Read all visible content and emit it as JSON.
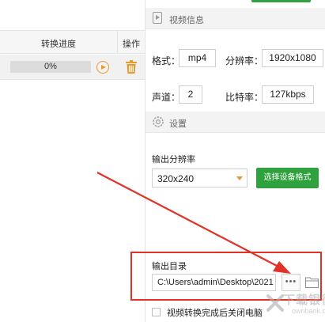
{
  "table": {
    "header": {
      "progress": "转换进度",
      "operation": "操作"
    },
    "rows": [
      {
        "progress_text": "0%",
        "progress": 0
      }
    ]
  },
  "video_info": {
    "title": "视频信息",
    "format_label": "格式：",
    "format_value": "mp4",
    "resolution_label": "分辨率：",
    "resolution_value": "1920x1080",
    "channels_label": "声道：",
    "channels_value": "2",
    "bitrate_label": "比特率：",
    "bitrate_value": "127kbps"
  },
  "settings": {
    "title": "设置",
    "output_resolution_label": "输出分辨率",
    "output_resolution_value": "320x240",
    "choose_format_button": "选择设备格式",
    "output_dir_label": "输出目录",
    "output_dir_value": "C:\\Users\\admin\\Desktop\\2021",
    "more_button": "•••",
    "shutdown_label": "视频转换完成后关闭电脑",
    "shutdown_checked": false
  },
  "watermark": {
    "cn": "下载银行",
    "en": "ownbank.cn"
  },
  "colors": {
    "accent": "#2fa13e",
    "orange": "#e69b2c",
    "annotation": "#e03226"
  },
  "icons": {
    "play": "play-icon",
    "trash": "trash-icon",
    "video": "video-icon",
    "gear": "gear-icon",
    "folder": "folder-icon"
  }
}
